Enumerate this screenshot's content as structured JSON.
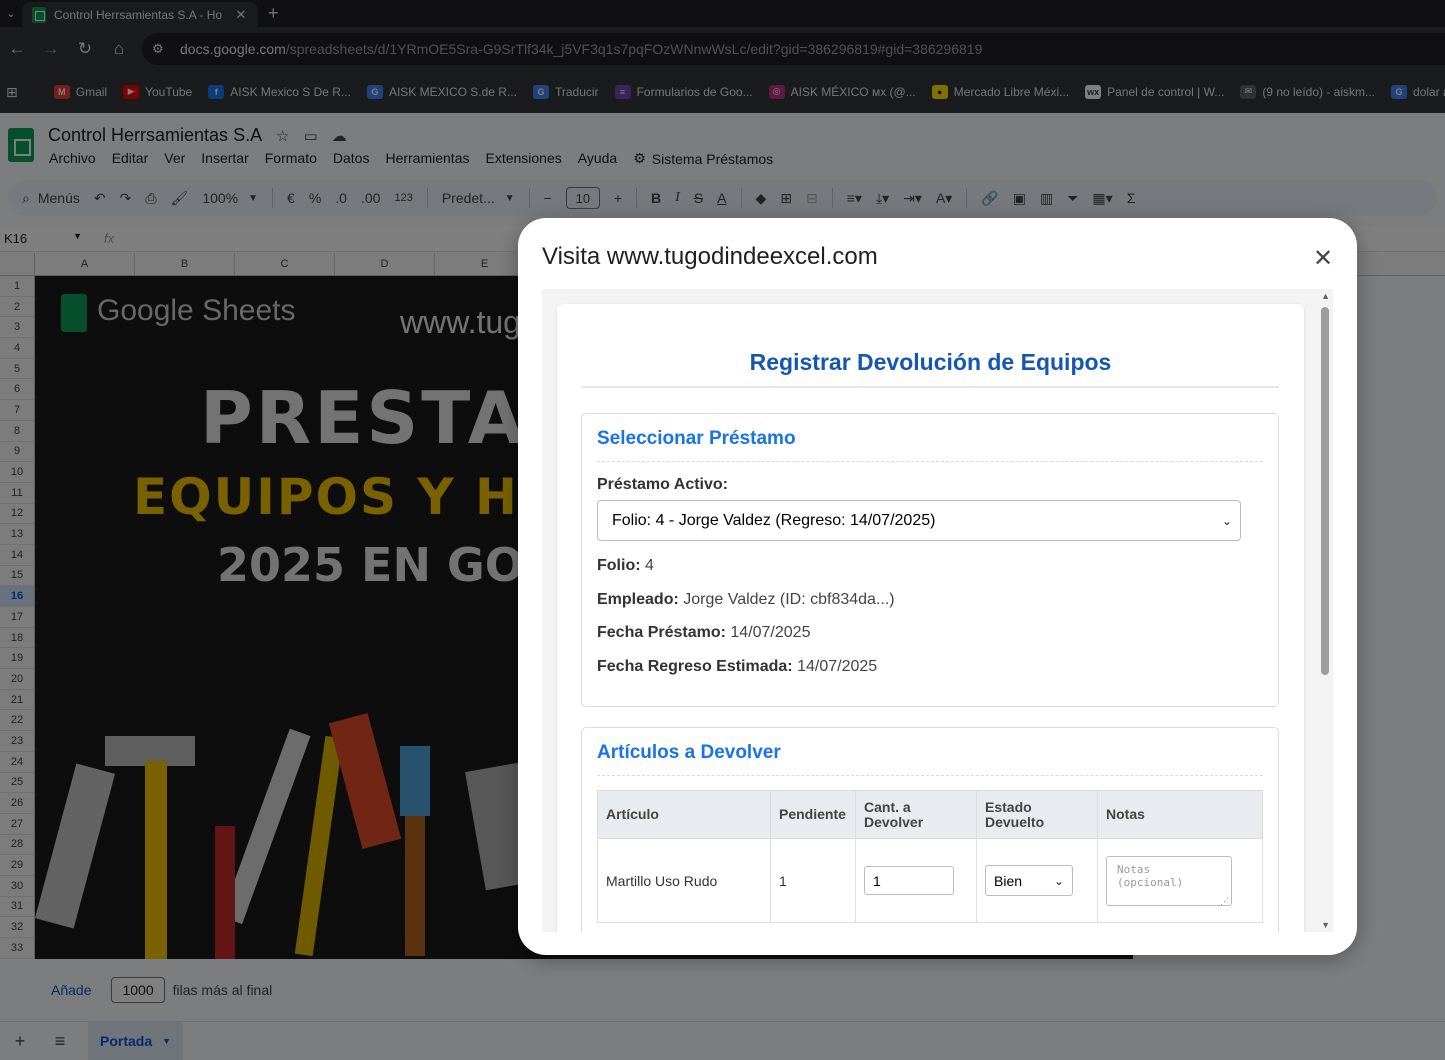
{
  "browser": {
    "tab_title": "Control Herrsamientas S.A - Ho",
    "tab_close": "✕",
    "new_tab": "+",
    "url_host": "docs.google.com",
    "url_path": "/spreadsheets/d/1YRmOE5Sra-G9SrTlf34k_j5VF3q1s7pqFOzWNnwWsLc/edit?gid=386296819#gid=386296819",
    "bookmarks": [
      {
        "label": "Gmail",
        "color": "#ea4335",
        "glyph": "M"
      },
      {
        "label": "YouTube",
        "color": "#ff0000",
        "glyph": "▶"
      },
      {
        "label": "AISK Mexico S De R...",
        "color": "#1877f2",
        "glyph": "f"
      },
      {
        "label": "AISK MEXICO S.de R...",
        "color": "#4285f4",
        "glyph": "G"
      },
      {
        "label": "Traducir",
        "color": "#4285f4",
        "glyph": "G"
      },
      {
        "label": "Formularios de Goo...",
        "color": "#7248b9",
        "glyph": "≡"
      },
      {
        "label": "AISK MÉXICO ᴍx (@...",
        "color": "#c13584",
        "glyph": "◎"
      },
      {
        "label": "Mercado Libre Méxi...",
        "color": "#ffe600",
        "glyph": "●"
      },
      {
        "label": "Panel de control | W...",
        "color": "#ffffff",
        "glyph": "wx"
      },
      {
        "label": "(9 no leído) - aiskm...",
        "color": "#5f6368",
        "glyph": "✉"
      },
      {
        "label": "dolar a peso -",
        "color": "#4285f4",
        "glyph": "G"
      }
    ]
  },
  "sheets": {
    "doc_title": "Control Herrsamientas S.A",
    "menus": [
      "Archivo",
      "Editar",
      "Ver",
      "Insertar",
      "Formato",
      "Datos",
      "Herramientas",
      "Extensiones",
      "Ayuda"
    ],
    "extension_menu": "Sistema Préstamos",
    "toolbar": {
      "search": "Menús",
      "zoom": "100%",
      "currency": "€",
      "percent": "%",
      "dec_less": ".0",
      "dec_more": ".00",
      "number_format": "123",
      "font": "Predet...",
      "font_size": "10"
    },
    "name_box": "K16",
    "fx": "fx",
    "columns": [
      "A",
      "B",
      "C",
      "D",
      "E"
    ],
    "rows": [
      "1",
      "2",
      "3",
      "4",
      "5",
      "6",
      "7",
      "8",
      "9",
      "10",
      "11",
      "12",
      "13",
      "14",
      "15",
      "16",
      "17",
      "18",
      "19",
      "20",
      "21",
      "22",
      "23",
      "24",
      "25",
      "26",
      "27",
      "28",
      "29",
      "30",
      "31",
      "32",
      "33"
    ],
    "selected_row": "16",
    "banner": {
      "brand": "Google Sheets",
      "url": "www.tug",
      "line1": "PRESTA",
      "line2": "EQUIPOS Y H",
      "line3": "2025 EN GO"
    },
    "add_rows": {
      "button": "Añade",
      "count": "1000",
      "suffix": "filas más al final"
    },
    "sheet_tab": "Portada"
  },
  "modal": {
    "title": "Visita www.tugodindeexcel.com",
    "close": "✕",
    "heading": "Registrar Devolución de Equipos",
    "select_section": {
      "title": "Seleccionar Préstamo",
      "active_label": "Préstamo Activo:",
      "selected_option": "Folio: 4 - Jorge Valdez (Regreso: 14/07/2025)",
      "folio_label": "Folio:",
      "folio_value": "4",
      "employee_label": "Empleado:",
      "employee_value": "Jorge Valdez (ID: cbf834da...)",
      "loan_date_label": "Fecha Préstamo:",
      "loan_date_value": "14/07/2025",
      "return_date_label": "Fecha Regreso Estimada:",
      "return_date_value": "14/07/2025"
    },
    "items_section": {
      "title": "Artículos a Devolver",
      "headers": {
        "article": "Artículo",
        "pending": "Pendiente",
        "qty_1": "Cant. a",
        "qty_2": "Devolver",
        "state_1": "Estado",
        "state_2": "Devuelto",
        "notes": "Notas"
      },
      "rows": [
        {
          "article": "Martillo Uso Rudo",
          "pending": "1",
          "qty": "1",
          "state": "Bien",
          "notes_placeholder": "Notas (opcional)"
        }
      ]
    }
  }
}
